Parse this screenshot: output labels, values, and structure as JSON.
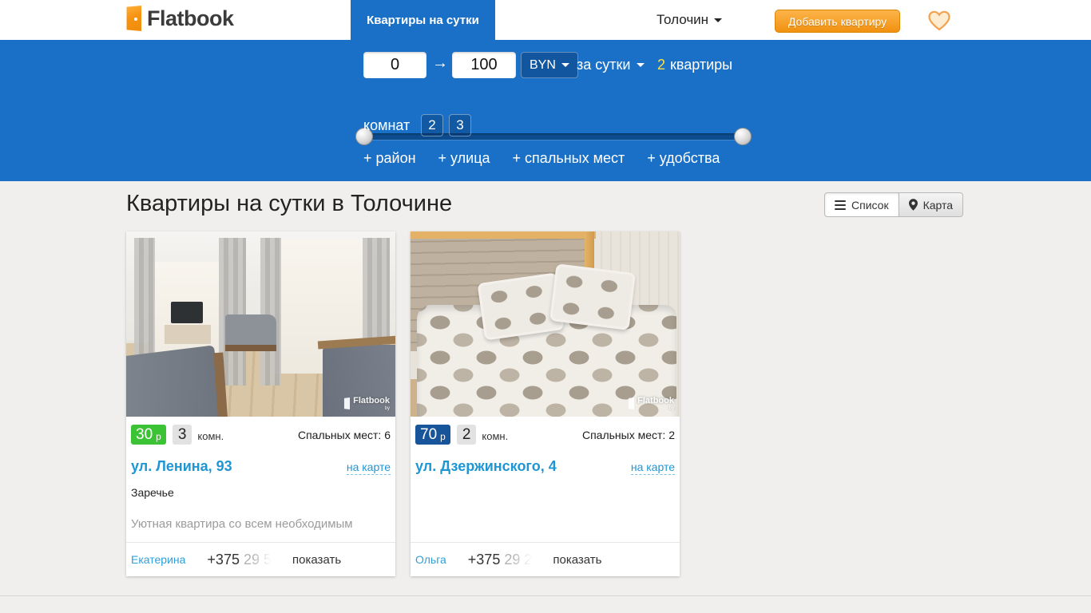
{
  "brand": {
    "name": "Flatbook",
    "domain_suffix": "by"
  },
  "nav": {
    "tab": "Квартиры на сутки",
    "city": "Толочин",
    "add_button": "Добавить квартиру"
  },
  "filters": {
    "price_from": "0",
    "price_to": "100",
    "arrow": "→",
    "currency": "BYN",
    "period": "за сутки",
    "count_value": "2",
    "count_label": "квартиры",
    "rooms_label": "комнат",
    "rooms_options": [
      "2",
      "3"
    ],
    "extra": {
      "district": "+ район",
      "street": "+ улица",
      "beds": "+ спальных мест",
      "amenities": "+ удобства"
    }
  },
  "view": {
    "title": "Квартиры на сутки в Толочине",
    "list": "Список",
    "map": "Карта"
  },
  "listings": [
    {
      "price": "30",
      "price_unit": "р",
      "rooms": "3",
      "rooms_suffix": "комн.",
      "beds": "Спальных мест: 6",
      "address": "ул. Ленина, 93",
      "map_link": "на карте",
      "district": "Заречье",
      "description": "Уютная квартира со всем необходимым",
      "contact": "Екатерина",
      "phone_prefix": "+375",
      "phone_hidden": "29 5",
      "show_phone": "показать"
    },
    {
      "price": "70",
      "price_unit": "р",
      "rooms": "2",
      "rooms_suffix": "комн.",
      "beds": "Спальных мест: 2",
      "address": "ул. Дзержинского, 4",
      "map_link": "на карте",
      "contact": "Ольга",
      "phone_prefix": "+375",
      "phone_hidden": "29 2",
      "show_phone": "показать"
    }
  ],
  "colors": {
    "accent_blue": "#1a70c6",
    "accent_orange": "#f19110",
    "price_green": "#3cc335",
    "price_blue": "#17549a",
    "link_blue": "#1f96d4",
    "count_yellow": "#ffdf3e"
  }
}
